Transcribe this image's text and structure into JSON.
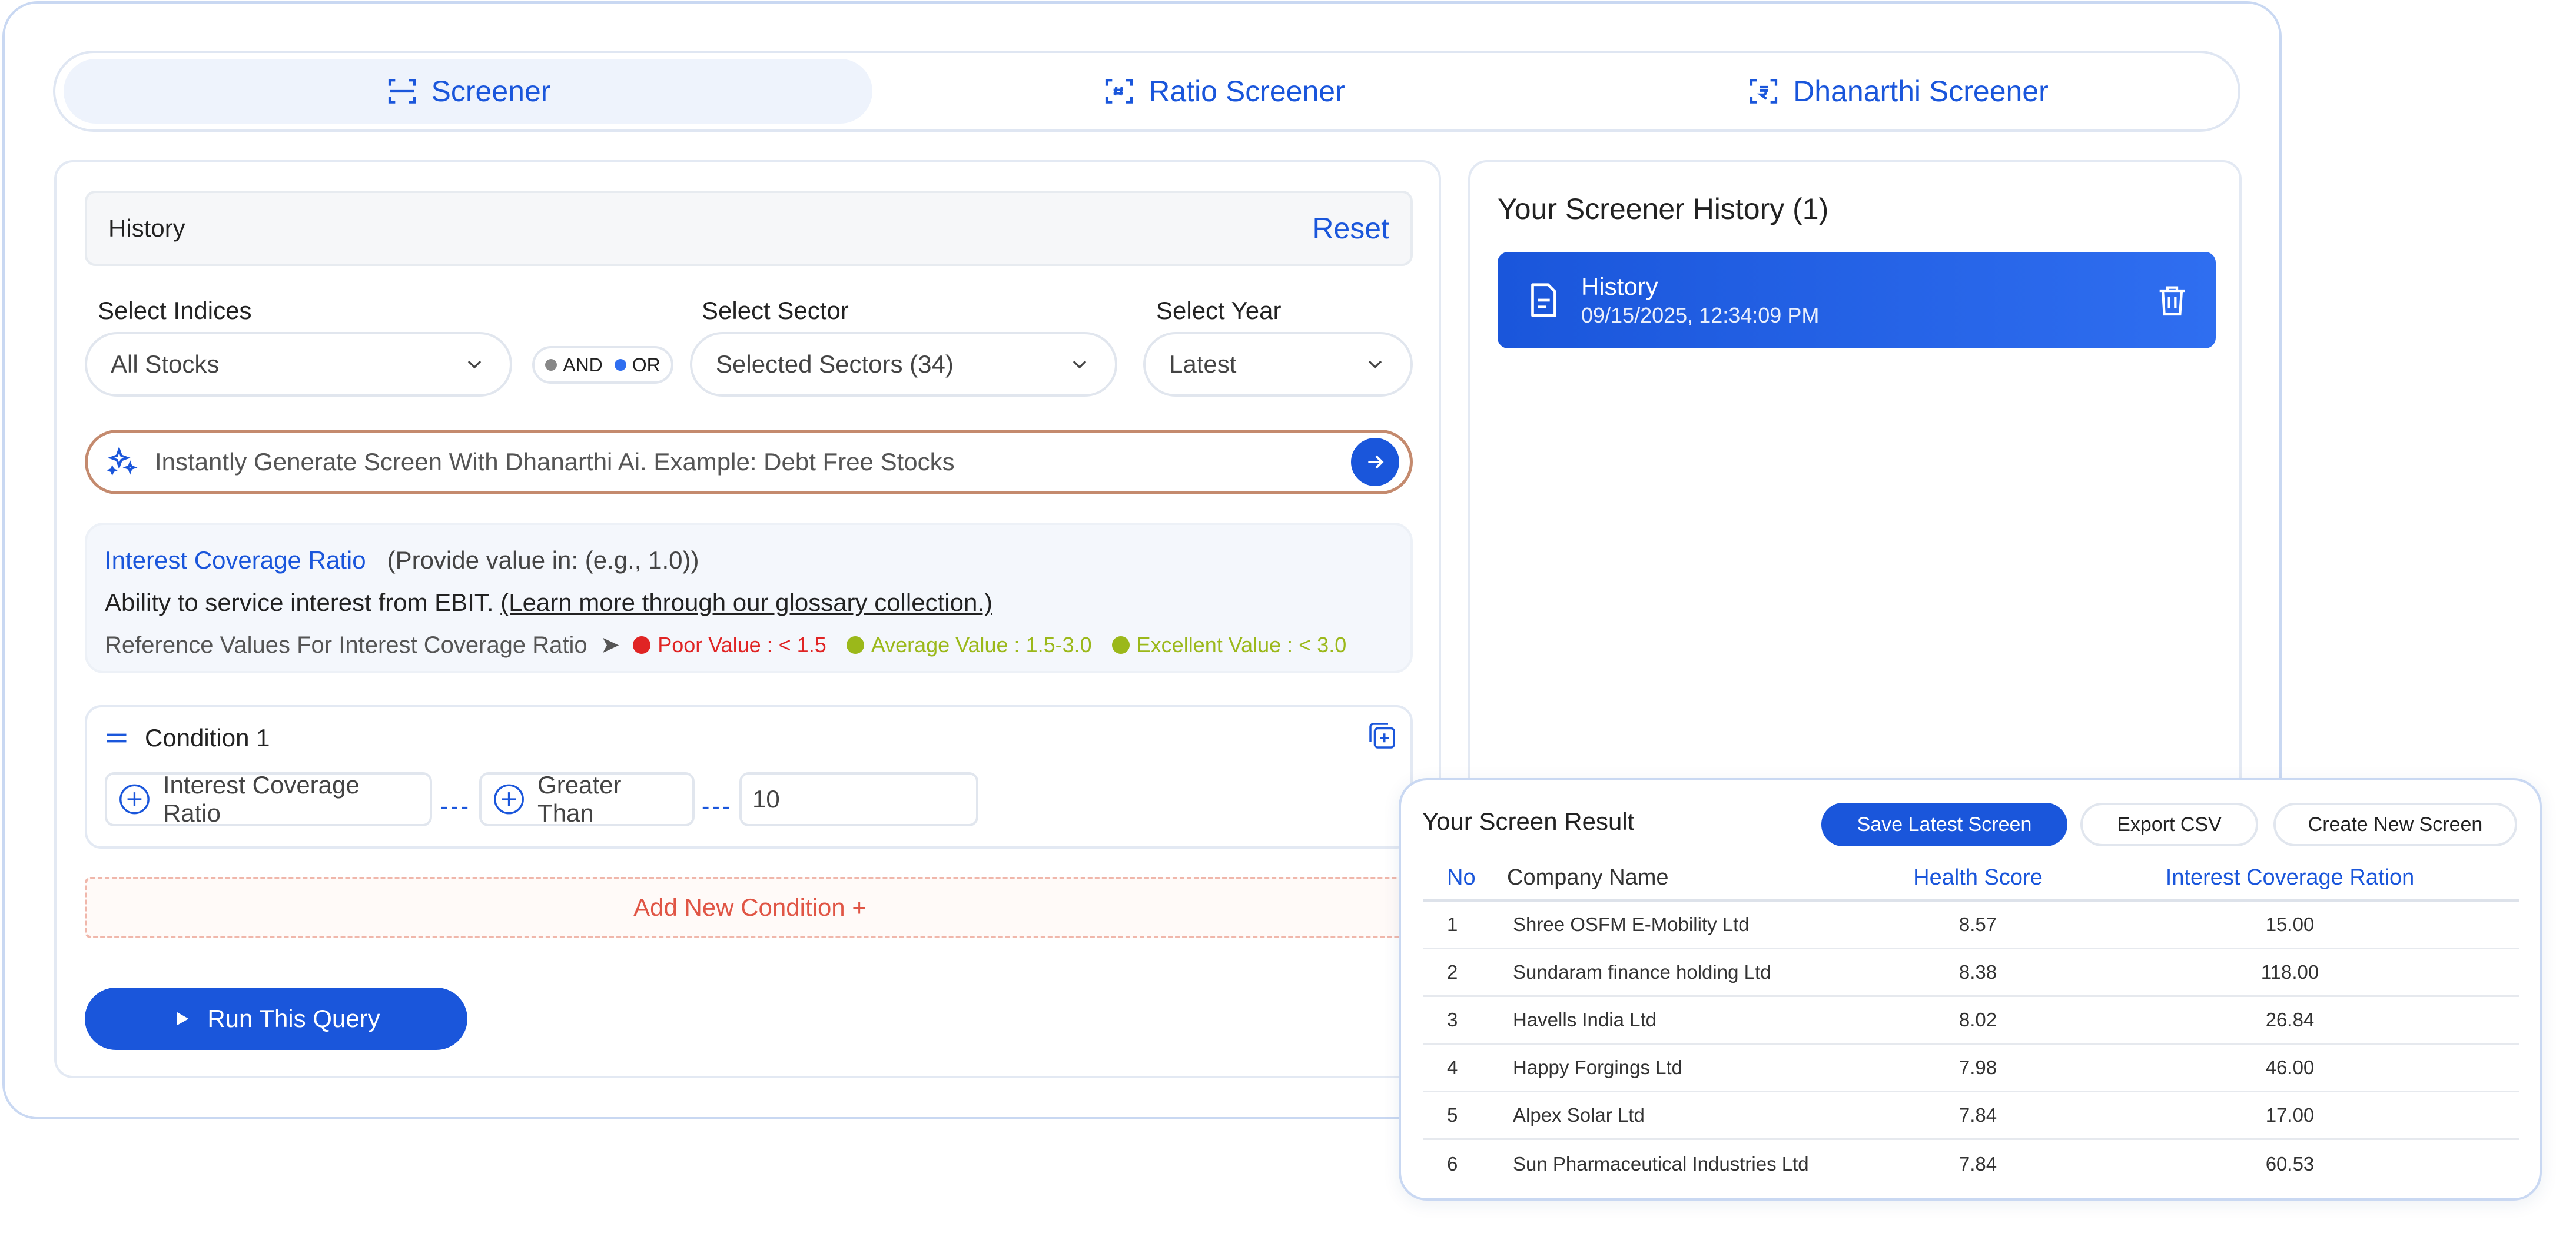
{
  "tabs": [
    {
      "label": "Screener",
      "icon": "screener-icon",
      "active": true
    },
    {
      "label": "Ratio Screener",
      "icon": "ratio-icon",
      "active": false
    },
    {
      "label": "Dhanarthi Screener",
      "icon": "dhanarthi-icon",
      "active": false
    }
  ],
  "history_bar": {
    "title": "History",
    "reset_label": "Reset"
  },
  "filters": {
    "indices": {
      "label": "Select Indices",
      "value": "All Stocks"
    },
    "logic": {
      "and_label": "AND",
      "or_label": "OR",
      "selected": "OR"
    },
    "sector": {
      "label": "Select Sector",
      "value": "Selected Sectors (34)"
    },
    "year": {
      "label": "Select Year",
      "value": "Latest"
    }
  },
  "ai_search": {
    "placeholder": "Instantly Generate Screen With Dhanarthi Ai. Example: Debt Free Stocks"
  },
  "info": {
    "ratio_name": "Interest Coverage Ratio",
    "value_hint": "(Provide value in: (e.g., 1.0))",
    "description": "Ability to service interest from EBIT.",
    "glossary_link": "(Learn more through our glossary collection.)",
    "reference_label": "Reference Values For Interest Coverage Ratio",
    "poor": "Poor Value : < 1.5",
    "average": "Average Value : 1.5-3.0",
    "excellent": "Excellent Value : < 3.0",
    "colors": {
      "poor": "#e02424",
      "average": "#9bb81a",
      "excellent": "#9bb81a"
    }
  },
  "condition": {
    "title": "Condition 1",
    "field": "Interest Coverage Ratio",
    "operator": "Greater Than",
    "value": "10"
  },
  "add_condition_label": "Add New Condition +",
  "run_button_label": "Run This Query",
  "screener_history": {
    "title": "Your Screener History (1)",
    "items": [
      {
        "name": "History",
        "date": "09/15/2025, 12:34:09 PM"
      }
    ]
  },
  "result": {
    "title": "Your Screen Result",
    "buttons": {
      "save": "Save Latest Screen",
      "export": "Export CSV",
      "create": "Create New Screen"
    },
    "columns": [
      "No",
      "Company Name",
      "Health Score",
      "Interest Coverage Ration"
    ],
    "rows": [
      [
        "1",
        "Shree OSFM E-Mobility Ltd",
        "8.57",
        "15.00"
      ],
      [
        "2",
        "Sundaram finance holding Ltd",
        "8.38",
        "118.00"
      ],
      [
        "3",
        "Havells India Ltd",
        "8.02",
        "26.84"
      ],
      [
        "4",
        "Happy Forgings Ltd",
        "7.98",
        "46.00"
      ],
      [
        "5",
        "Alpex Solar Ltd",
        "7.84",
        "17.00"
      ],
      [
        "6",
        "Sun Pharmaceutical Industries Ltd",
        "7.84",
        "60.53"
      ]
    ]
  },
  "accent_color": "#1a56db"
}
